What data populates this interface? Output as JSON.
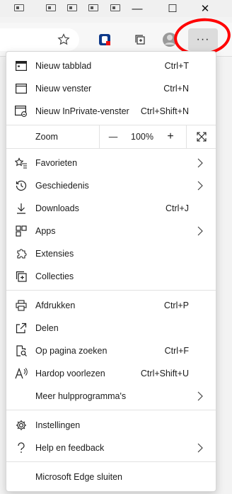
{
  "window": {
    "minimize_glyph": "—",
    "maximize_glyph": "☐",
    "close_glyph": "✕"
  },
  "toolbar": {
    "more_glyph": "···",
    "accent_color": "#f00"
  },
  "menu": {
    "new_tab": {
      "label": "Nieuw tabblad",
      "shortcut": "Ctrl+T",
      "icon": "new-tab-icon"
    },
    "new_window": {
      "label": "Nieuw venster",
      "shortcut": "Ctrl+N",
      "icon": "window-icon"
    },
    "inprivate": {
      "label": "Nieuw InPrivate-venster",
      "shortcut": "Ctrl+Shift+N",
      "icon": "inprivate-icon"
    },
    "zoom": {
      "label": "Zoom",
      "minus": "—",
      "value": "100%",
      "plus": "+"
    },
    "favorites": {
      "label": "Favorieten",
      "icon": "favorites-icon"
    },
    "history": {
      "label": "Geschiedenis",
      "icon": "history-icon"
    },
    "downloads": {
      "label": "Downloads",
      "shortcut": "Ctrl+J",
      "icon": "download-icon"
    },
    "apps": {
      "label": "Apps",
      "icon": "apps-icon"
    },
    "extensions": {
      "label": "Extensies",
      "icon": "puzzle-icon"
    },
    "collections": {
      "label": "Collecties",
      "icon": "collections-icon"
    },
    "print": {
      "label": "Afdrukken",
      "shortcut": "Ctrl+P",
      "icon": "printer-icon"
    },
    "share": {
      "label": "Delen",
      "icon": "share-icon"
    },
    "find": {
      "label": "Op pagina zoeken",
      "shortcut": "Ctrl+F",
      "icon": "find-icon"
    },
    "read_aloud": {
      "label": "Hardop voorlezen",
      "shortcut": "Ctrl+Shift+U",
      "icon": "read-aloud-icon"
    },
    "more_tools": {
      "label": "Meer hulpprogramma's"
    },
    "settings": {
      "label": "Instellingen",
      "icon": "gear-icon"
    },
    "help": {
      "label": "Help en feedback",
      "icon": "question-icon"
    },
    "close_edge": {
      "label": "Microsoft Edge sluiten"
    }
  }
}
